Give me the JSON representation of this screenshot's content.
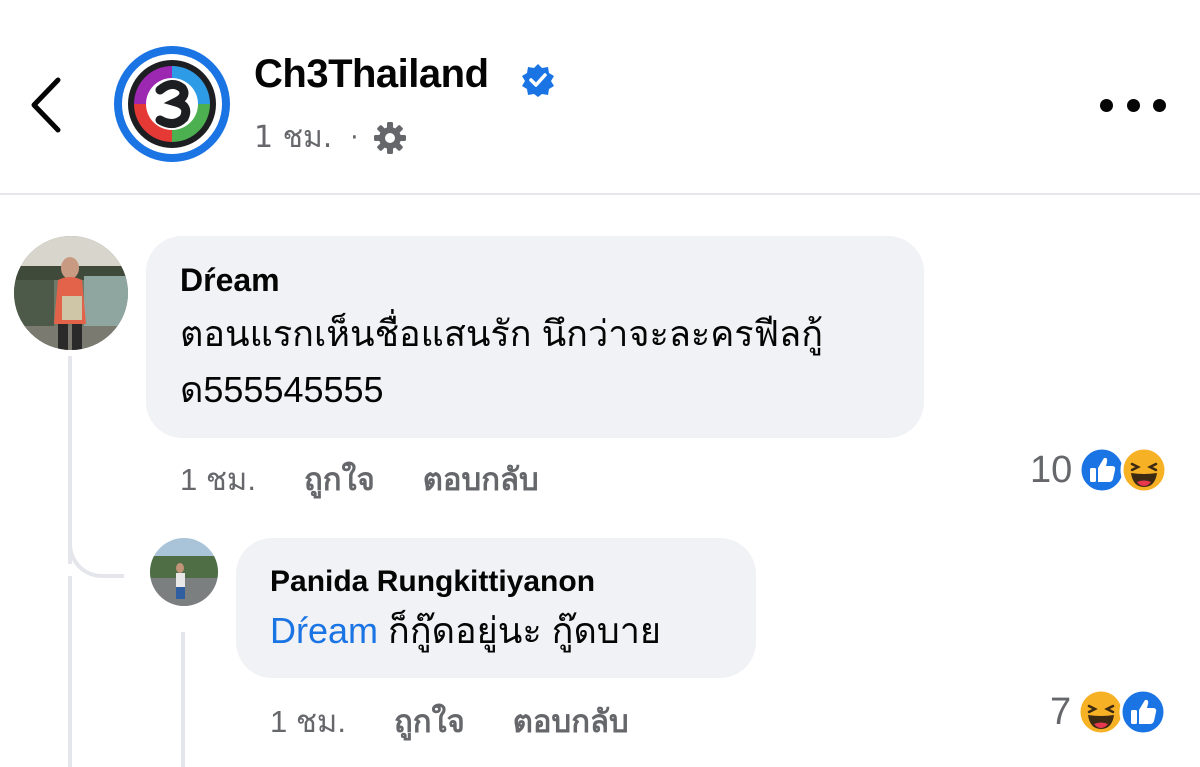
{
  "header": {
    "page_name": "Ch3Thailand",
    "time": "1 ชม.",
    "separator": "·"
  },
  "comments": [
    {
      "author": "Dŕeam",
      "text_line1": "ตอนแรกเห็นชื่อแสนรัก นึกว่าจะละครฟีลกู้",
      "text_line2": "ด555545555",
      "time": "1 ชม.",
      "like_label": "ถูกใจ",
      "reply_label": "ตอบกลับ",
      "reaction_count": "10",
      "reactions": [
        "like-icon",
        "haha-icon"
      ]
    },
    {
      "author": "Panida Rungkittiyanon",
      "mention": "Dŕeam",
      "text": " ก็กู๊ดอยู่นะ กู๊ดบาย",
      "time": "1 ชม.",
      "like_label": "ถูกใจ",
      "reply_label": "ตอบกลับ",
      "reaction_count": "7",
      "reactions": [
        "haha-icon",
        "like-icon"
      ]
    }
  ],
  "colors": {
    "accent": "#1b74e4",
    "bubble": "#f0f2f5",
    "secondary_text": "#65676b"
  }
}
